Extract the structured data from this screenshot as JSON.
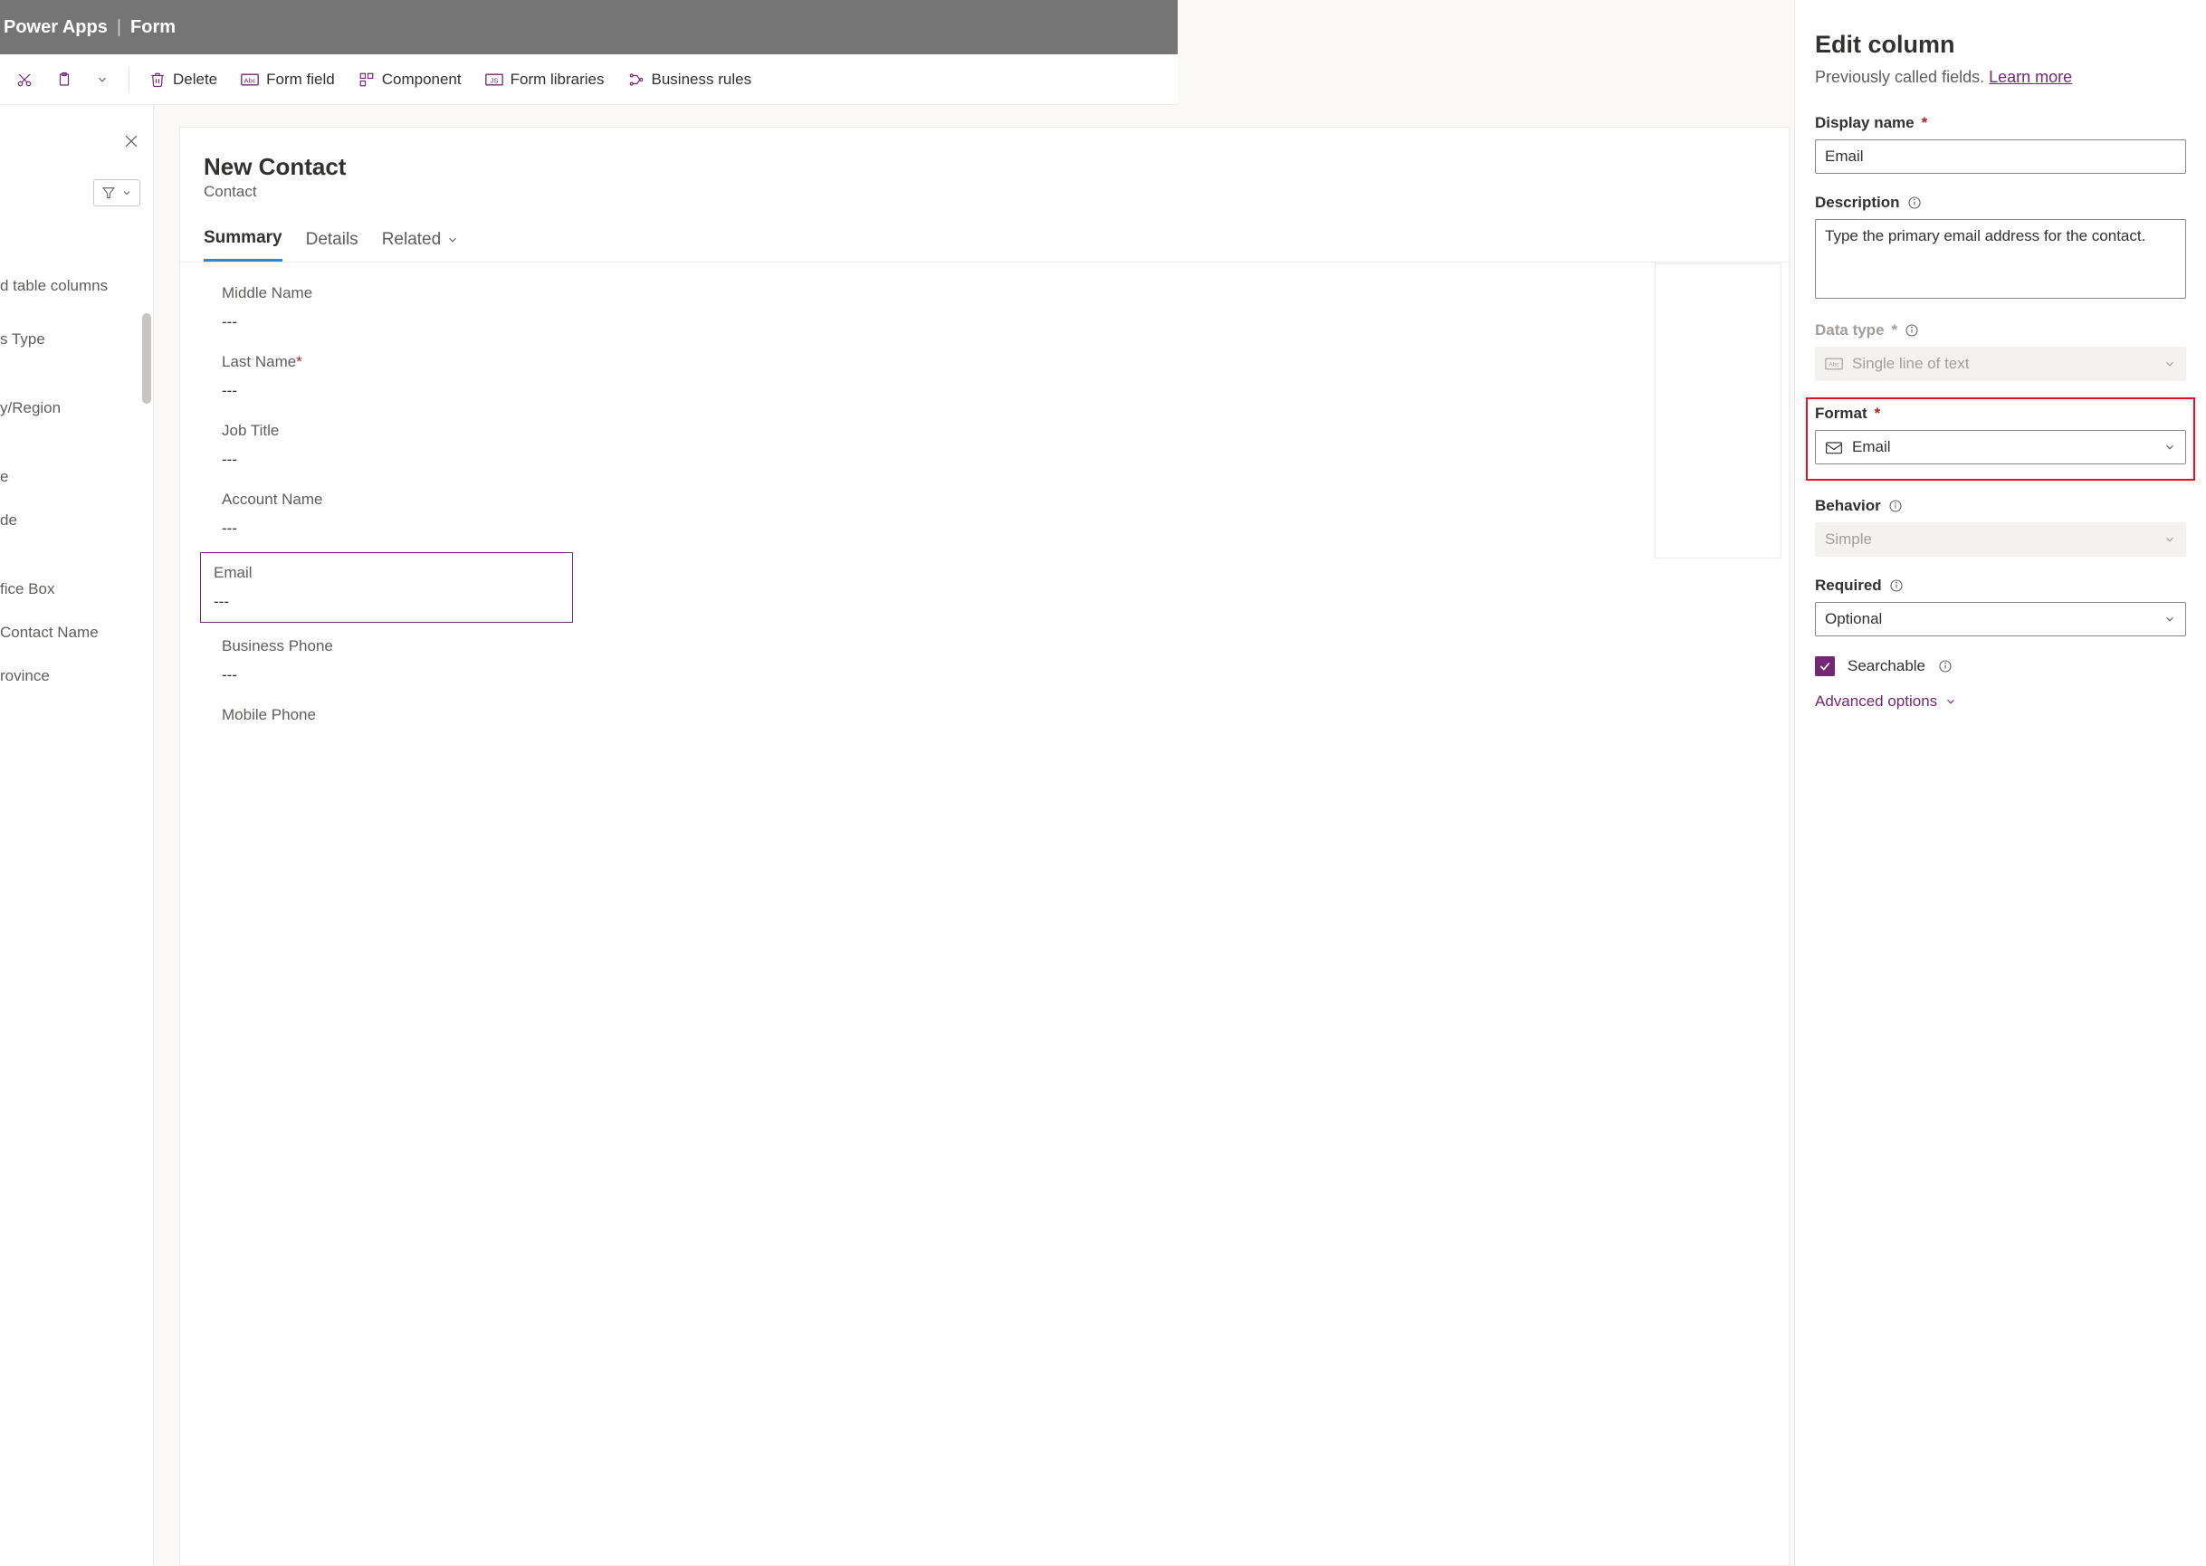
{
  "header": {
    "app": "Power Apps",
    "context": "Form"
  },
  "toolbar": {
    "delete": "Delete",
    "form_field": "Form field",
    "component": "Component",
    "form_libraries": "Form libraries",
    "business_rules": "Business rules"
  },
  "left": {
    "heading": "d table columns",
    "items": [
      "s Type",
      "",
      "y/Region",
      "",
      "e",
      "de",
      "",
      "fice Box",
      "Contact Name",
      "rovince"
    ]
  },
  "form": {
    "title": "New Contact",
    "subtitle": "Contact",
    "tabs": {
      "summary": "Summary",
      "details": "Details",
      "related": "Related"
    },
    "fields": {
      "middle_name": {
        "label": "Middle Name",
        "value": "---"
      },
      "last_name": {
        "label": "Last Name",
        "value": "---",
        "required": true
      },
      "job_title": {
        "label": "Job Title",
        "value": "---"
      },
      "account": {
        "label": "Account Name",
        "value": "---"
      },
      "email": {
        "label": "Email",
        "value": "---"
      },
      "bphone": {
        "label": "Business Phone",
        "value": "---"
      },
      "mphone": {
        "label": "Mobile Phone",
        "value": ""
      }
    }
  },
  "panel": {
    "title": "Edit column",
    "subtext": "Previously called fields.",
    "learn_more": "Learn more",
    "display_name_label": "Display name",
    "display_name_value": "Email",
    "description_label": "Description",
    "description_value": "Type the primary email address for the contact.",
    "data_type_label": "Data type",
    "data_type_value": "Single line of text",
    "format_label": "Format",
    "format_value": "Email",
    "behavior_label": "Behavior",
    "behavior_value": "Simple",
    "required_label": "Required",
    "required_value": "Optional",
    "searchable_label": "Searchable",
    "advanced": "Advanced options"
  }
}
